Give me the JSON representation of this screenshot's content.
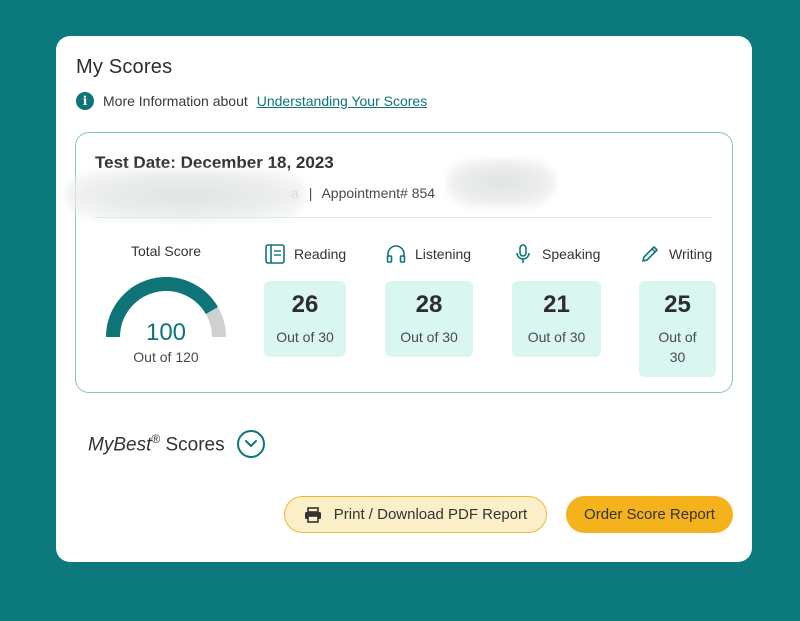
{
  "card": {
    "title": "My Scores",
    "info_text": "More Information about",
    "info_link": "Understanding Your Scores"
  },
  "test": {
    "date_label": "Test Date: December 18, 2023",
    "name_fragment": "a",
    "separator": "|",
    "appointment_label": "Appointment# 854",
    "redacted": true
  },
  "total": {
    "label": "Total Score",
    "value": "100",
    "out_of": "Out of 120",
    "fraction": 0.8333
  },
  "sections": [
    {
      "name": "Reading",
      "icon": "book-icon",
      "score": "26",
      "out_of": "Out of 30"
    },
    {
      "name": "Listening",
      "icon": "headphones-icon",
      "score": "28",
      "out_of": "Out of 30"
    },
    {
      "name": "Speaking",
      "icon": "microphone-icon",
      "score": "21",
      "out_of": "Out of 30"
    },
    {
      "name": "Writing",
      "icon": "pencil-icon",
      "score": "25",
      "out_of_line1": "Out of",
      "out_of_line2": "30"
    }
  ],
  "mybest": {
    "prefix": "MyBest",
    "registered": "®",
    "suffix": "Scores",
    "icon": "chevron-down-icon"
  },
  "actions": {
    "print_label": "Print / Download PDF Report",
    "print_icon": "printer-icon",
    "order_label": "Order Score Report"
  },
  "colors": {
    "background": "#0c7a7c",
    "accent": "#0f7478",
    "tile": "#d9f6f1",
    "gauge_remaining": "#d0d0d0",
    "button_yellow": "#f4b21c"
  }
}
